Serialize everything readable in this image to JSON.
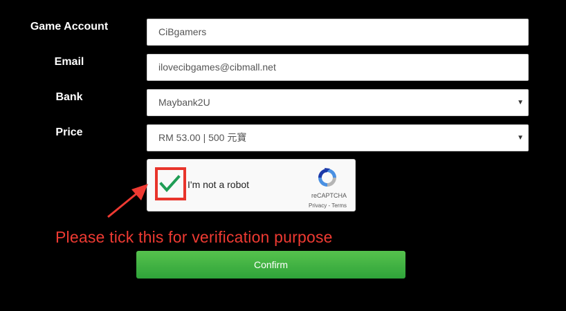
{
  "form": {
    "game_account_label": "Game Account",
    "game_account_value": "CiBgamers",
    "email_label": "Email",
    "email_value": "ilovecibgames@cibmall.net",
    "bank_label": "Bank",
    "bank_selected": "Maybank2U",
    "price_label": "Price",
    "price_selected": "RM 53.00 | 500 元寶",
    "select_caret": "▼",
    "confirm_label": "Confirm"
  },
  "recaptcha": {
    "label": "I'm not a robot",
    "brand": "reCAPTCHA",
    "privacy": "Privacy",
    "separator": " - ",
    "terms": "Terms",
    "checked": true
  },
  "annotation": {
    "hint": "Please tick this for verification purpose",
    "color": "#ee3a32"
  },
  "colors": {
    "background": "#000000",
    "confirm_button": "#3cb042",
    "checkmark": "#1f9d55"
  }
}
